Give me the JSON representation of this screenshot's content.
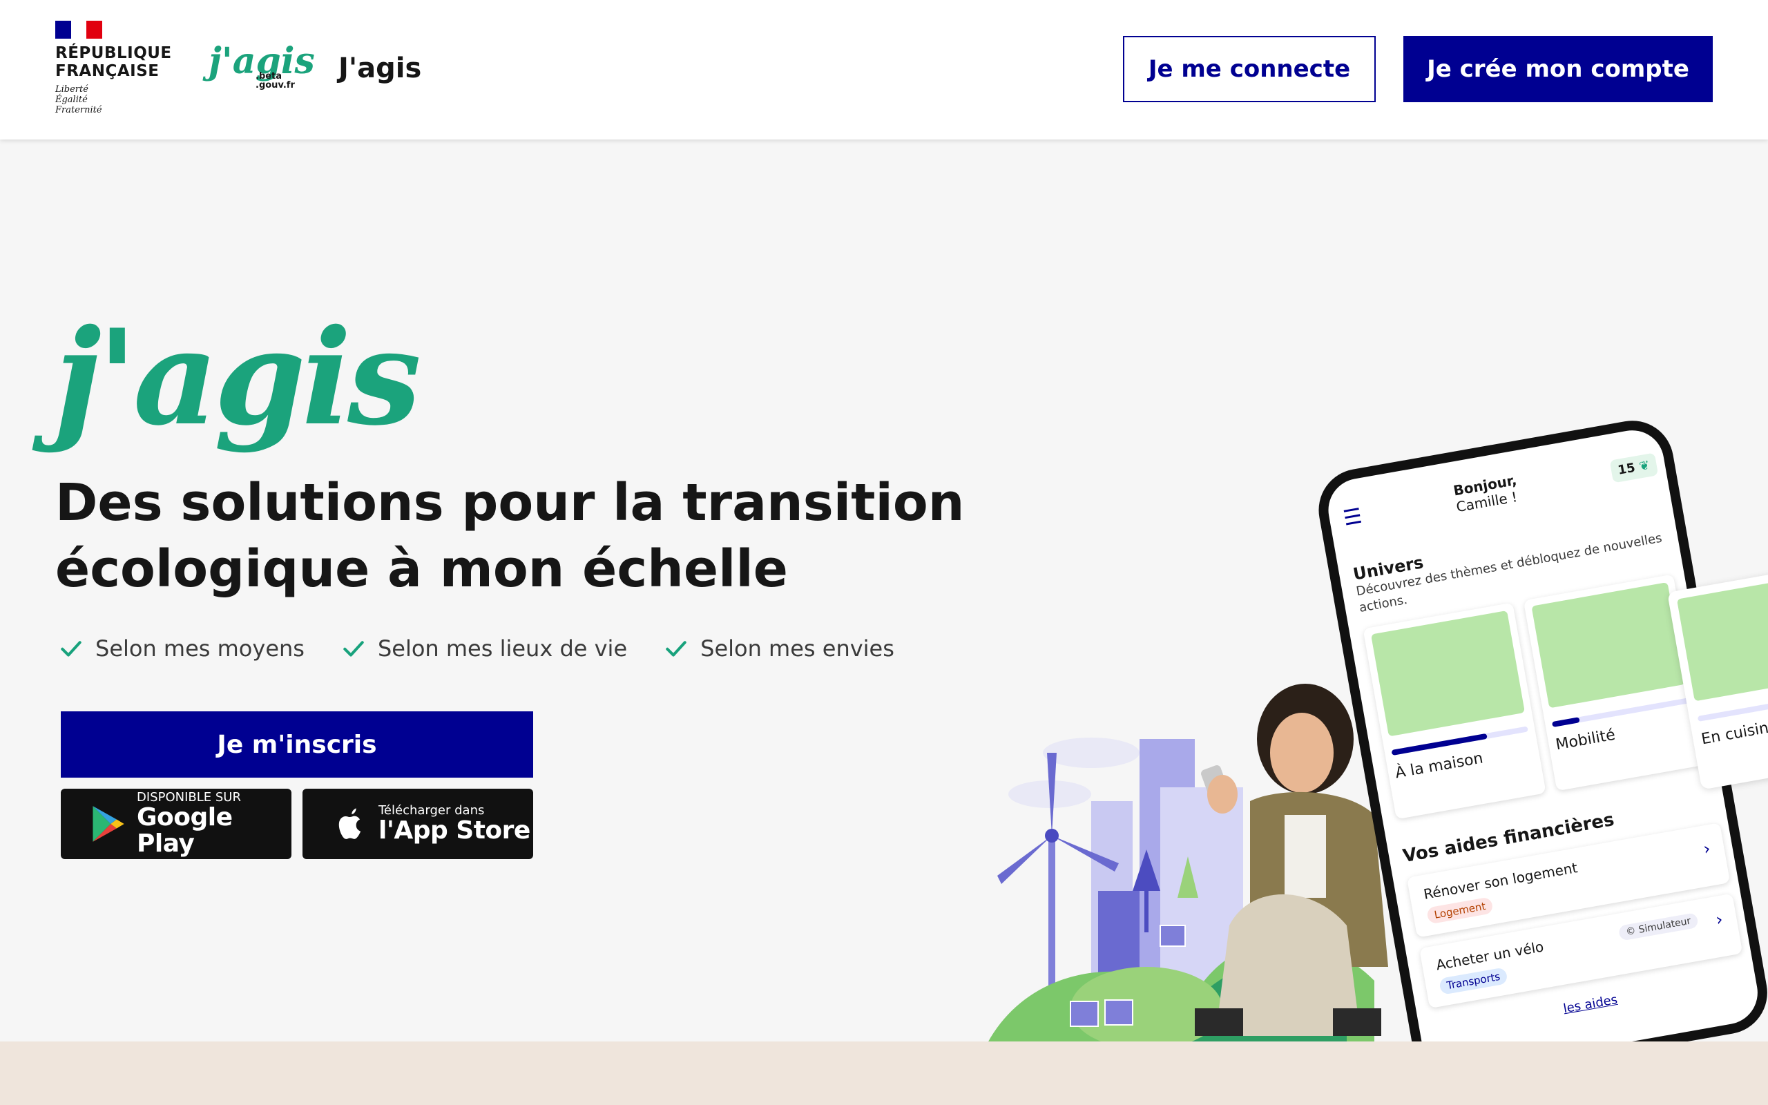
{
  "header": {
    "rf_line1": "RÉPUBLIQUE",
    "rf_line2": "FRANÇAISE",
    "devise": [
      "Liberté",
      "Égalité",
      "Fraternité"
    ],
    "logo_word": "j'agis",
    "beta_line1": ".beta",
    "beta_line2": ".gouv.fr",
    "site_name": "J'agis",
    "login_label": "Je me connecte",
    "signup_label": "Je crée mon compte"
  },
  "hero": {
    "logo_word": "j'agis",
    "title": "Des solutions pour la transition écologique à mon échelle",
    "checks": [
      "Selon mes moyens",
      "Selon mes lieux de vie",
      "Selon mes envies"
    ],
    "cta_label": "Je m'inscris",
    "google_play": {
      "small": "DISPONIBLE SUR",
      "big": "Google Play"
    },
    "app_store": {
      "small": "Télécharger dans",
      "big": "l'App Store"
    }
  },
  "phone": {
    "hello": "Bonjour,",
    "name": "Camille !",
    "points": "15",
    "univers_title": "Univers",
    "univers_sub": "Découvrez des thèmes et débloquez de nouvelles actions.",
    "cards": [
      {
        "label": "À la maison",
        "progress": 0.7
      },
      {
        "label": "Mobilité",
        "progress": 0.2
      }
    ],
    "side_card_label": "En cuisine",
    "aides_title": "Vos aides financières",
    "aides": [
      {
        "title": "Rénover son logement",
        "tag": "Logement",
        "tag_bg": "#fde4e4",
        "tag_color": "#b34000"
      },
      {
        "title": "Acheter un vélo",
        "tag": "Transports",
        "tag_bg": "#dbeafe",
        "tag_color": "#000091",
        "sim": "© Simulateur"
      }
    ],
    "more": "les aides"
  },
  "colors": {
    "brand_blue": "#000091",
    "jagis_green": "#1ba37c",
    "check_green": "#18a27c",
    "footer_band": "#efe5dc"
  }
}
